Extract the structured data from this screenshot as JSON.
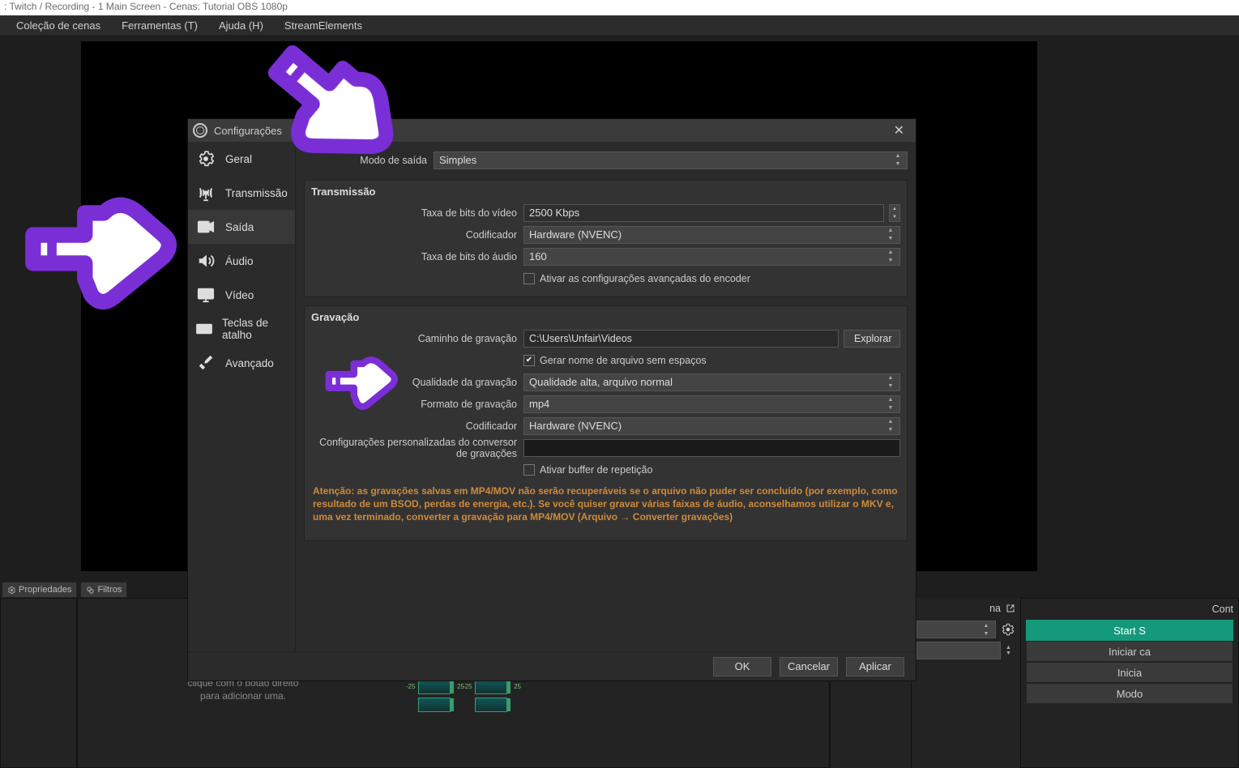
{
  "titlebar": ": Twitch / Recording - 1 Main Screen - Cenas: Tutorial OBS 1080p",
  "menubar": {
    "colecao": "Coleção de cenas",
    "ferramentas": "Ferramentas (T)",
    "ajuda": "Ajuda (H)",
    "stream": "StreamElements"
  },
  "dialog": {
    "title": "Configurações",
    "nav": [
      "Geral",
      "Transmissão",
      "Saída",
      "Áudio",
      "Vídeo",
      "Teclas de atalho",
      "Avançado"
    ],
    "active_nav": 2,
    "output_mode_label": "Modo de saída",
    "output_mode_value": "Simples",
    "streaming": {
      "title": "Transmissão",
      "video_bitrate_label": "Taxa de bits do vídeo",
      "video_bitrate_value": "2500 Kbps",
      "encoder_label": "Codificador",
      "encoder_value": "Hardware (NVENC)",
      "audio_bitrate_label": "Taxa de bits do áudio",
      "audio_bitrate_value": "160",
      "adv_checkbox_label": "Ativar as configurações avançadas do encoder"
    },
    "recording": {
      "title": "Gravação",
      "path_label": "Caminho de gravação",
      "path_value": "C:\\Users\\Unfair\\Videos",
      "browse": "Explorar",
      "nospace_label": "Gerar nome de arquivo sem espaços",
      "nospace_checked": true,
      "quality_label": "Qualidade da gravação",
      "quality_value": "Qualidade alta, arquivo normal",
      "format_label": "Formato de gravação",
      "format_value": "mp4",
      "encoder_label": "Codificador",
      "encoder_value": "Hardware (NVENC)",
      "muxer_label": "Configurações personalizadas do conversor de gravações",
      "replay_label": "Ativar buffer de repetição"
    },
    "warning": "Atenção: as gravações salvas em MP4/MOV não serão recuperáveis se o arquivo não puder ser concluído (por exemplo, como resultado de um BSOD, perdas de energia, etc.). Se você quiser gravar várias faixas de áudio, aconselhamos utilizar o MKV e, uma vez terminado, converter a gravação para MP4/MOV (Arquivo → Converter gravações)",
    "buttons": {
      "ok": "OK",
      "cancel": "Cancelar",
      "apply": "Aplicar"
    }
  },
  "bottom": {
    "prop": "Propriedades",
    "filt": "Filtros",
    "na_label": "na",
    "cont_label": "Cont",
    "start": "Start S",
    "rec": "Iniciar ca",
    "replay": "Inicia",
    "mode": "Modo"
  },
  "src_hint": "clique com o botão direito para adicionar uma.",
  "timeline": {
    "l": "-25",
    "r": "25"
  }
}
